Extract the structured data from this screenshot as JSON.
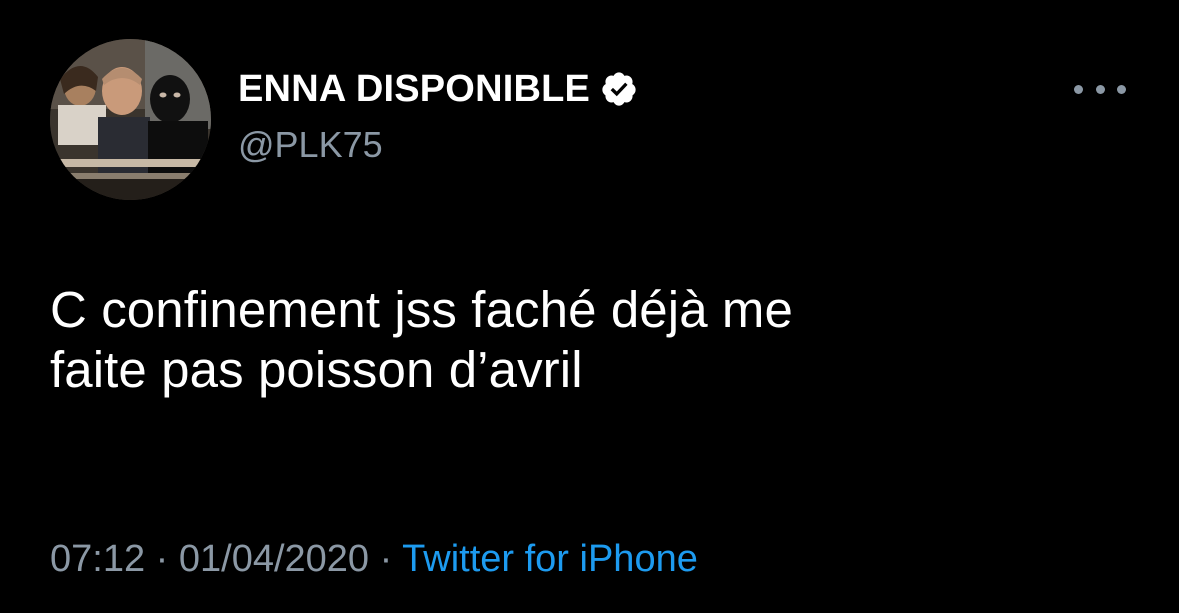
{
  "tweet": {
    "display_name": "ENNA DISPONIBLE",
    "verified": true,
    "handle": "@PLK75",
    "text_lines": [
      "C confinement jss faché déjà me",
      "faite pas poisson d’avril"
    ],
    "time": "07:12",
    "separator": "·",
    "date": "01/04/2020",
    "source": "Twitter for iPhone"
  },
  "icons": {
    "verified": "verified-badge-icon",
    "more": "more-options-icon"
  },
  "colors": {
    "background": "#000000",
    "primary_text": "#ffffff",
    "secondary_text": "#8b98a5",
    "link": "#1d9bf0"
  }
}
